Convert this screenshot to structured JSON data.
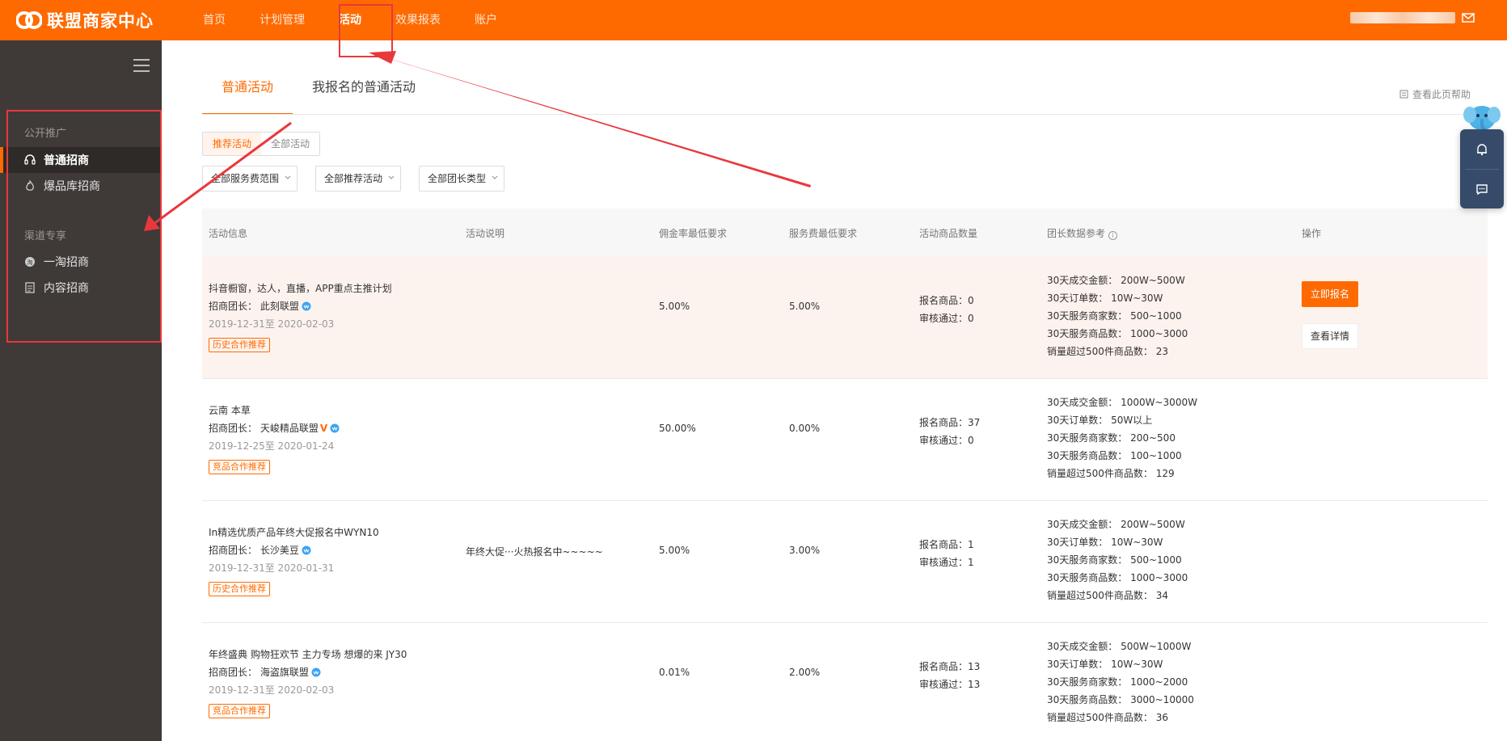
{
  "header": {
    "logo_text": "联盟商家中心",
    "nav": [
      "首页",
      "计划管理",
      "活动",
      "效果报表",
      "账户"
    ],
    "active_nav": "活动"
  },
  "sidebar": {
    "group1_title": "公开推广",
    "group1_items": [
      "普通招商",
      "爆品库招商"
    ],
    "group2_title": "渠道专享",
    "group2_items": [
      "一淘招商",
      "内容招商"
    ]
  },
  "tabs": [
    "普通活动",
    "我报名的普通活动"
  ],
  "help_link": "查看此页帮助",
  "segment": [
    "推荐活动",
    "全部活动"
  ],
  "filters": [
    "全部服务费范围",
    "全部推荐活动",
    "全部团长类型"
  ],
  "table": {
    "headers": [
      "活动信息",
      "活动说明",
      "佣金率最低要求",
      "服务费最低要求",
      "活动商品数量",
      "团长数据参考",
      "操作"
    ],
    "rows": [
      {
        "name": "抖音橱窗，达人，直播，APP重点主推计划",
        "leader": "招商团长： 此刻联盟",
        "date": "2019-12-31至 2020-02-03",
        "tag": "历史合作推荐",
        "desc": "",
        "commission": "5.00%",
        "fee": "5.00%",
        "count": [
          "报名商品：0",
          "审核通过：0"
        ],
        "ref": [
          "30天成交金额： 200W~500W",
          "30天订单数： 10W~30W",
          "30天服务商家数： 500~1000",
          "30天服务商品数： 1000~3000",
          "销量超过500件商品数： 23"
        ],
        "actions": [
          "立即报名",
          "查看详情"
        ]
      },
      {
        "name": "云南 本草",
        "leader": "招商团长： 天峻精品联盟",
        "date": "2019-12-25至 2020-01-24",
        "tag": "竞品合作推荐",
        "desc": "",
        "commission": "50.00%",
        "fee": "0.00%",
        "count": [
          "报名商品：37",
          "审核通过：0"
        ],
        "ref": [
          "30天成交金额： 1000W~3000W",
          "30天订单数： 50W以上",
          "30天服务商家数： 200~500",
          "30天服务商品数： 100~1000",
          "销量超过500件商品数： 129"
        ]
      },
      {
        "name": "In精选优质产品年终大促报名中WYN10",
        "leader": "招商团长： 长沙美豆",
        "date": "2019-12-31至 2020-01-31",
        "tag": "历史合作推荐",
        "desc": "年终大促···火热报名中~~~~~",
        "commission": "5.00%",
        "fee": "3.00%",
        "count": [
          "报名商品：1",
          "审核通过：1"
        ],
        "ref": [
          "30天成交金额： 200W~500W",
          "30天订单数： 10W~30W",
          "30天服务商家数： 500~1000",
          "30天服务商品数： 1000~3000",
          "销量超过500件商品数： 34"
        ]
      },
      {
        "name": "年终盛典 购物狂欢节 主力专场 想爆的来 JY30",
        "leader": "招商团长： 海盗旗联盟",
        "date": "2019-12-31至 2020-02-03",
        "tag": "竞品合作推荐",
        "desc": "",
        "commission": "0.01%",
        "fee": "2.00%",
        "count": [
          "报名商品：13",
          "审核通过：13"
        ],
        "ref": [
          "30天成交金额： 500W~1000W",
          "30天订单数： 10W~30W",
          "30天服务商家数： 1000~2000",
          "30天服务商品数： 3000~10000",
          "销量超过500件商品数： 36"
        ]
      }
    ]
  },
  "colors": {
    "brand": "#ff6a00",
    "sidebar": "#3f3a38",
    "annotation": "#e8383d"
  }
}
